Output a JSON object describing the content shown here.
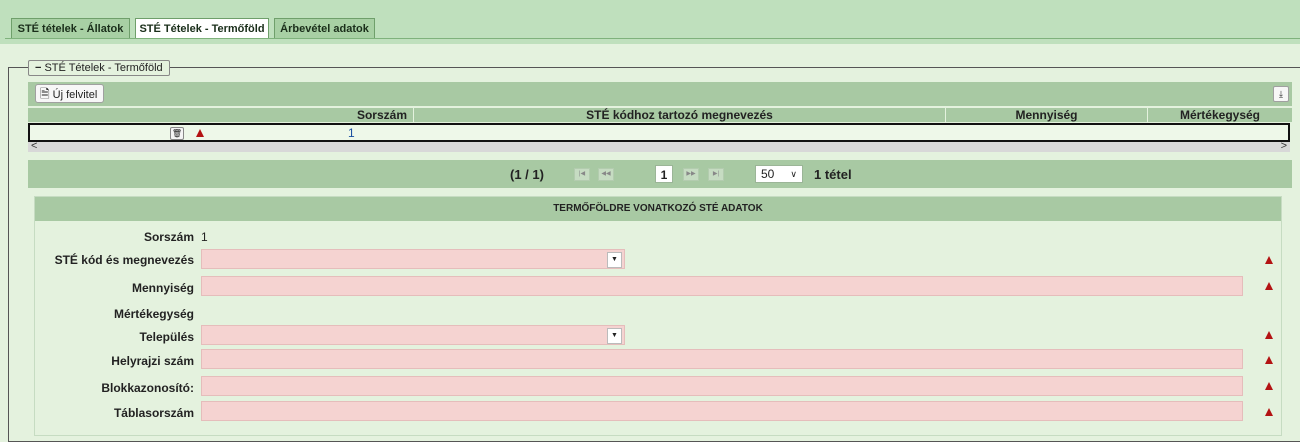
{
  "tabs": [
    {
      "label": "STÉ tételek - Állatok",
      "active": false
    },
    {
      "label": "STÉ Tételek - Termőföld",
      "active": true
    },
    {
      "label": "Árbevétel adatok",
      "active": false
    }
  ],
  "panel": {
    "legend": "STÉ Tételek - Termőföld",
    "collapse_glyph": "−",
    "new_button": "Új felvitel",
    "new_icon": "document-icon",
    "export_icon": "download-icon"
  },
  "table": {
    "columns": [
      "Sorszám",
      "STÉ kódhoz tartozó megnevezés",
      "Mennyiség",
      "Mértékegység"
    ],
    "rows": [
      {
        "sorszam": "1",
        "megnevezes": "",
        "mennyiseg": "",
        "mertekegyseg": ""
      }
    ]
  },
  "scroll": {
    "left": "<",
    "right": ">"
  },
  "pager": {
    "position": "(1 / 1)",
    "current_page": "1",
    "page_size": "50",
    "total": "1 tétel",
    "buttons": {
      "first": "|◀",
      "prev": "◀◀",
      "next": "▶▶",
      "last": "▶|"
    }
  },
  "form": {
    "title": "TERMŐFÖLDRE VONATKOZÓ STÉ ADATOK",
    "fields": {
      "sorszam": {
        "label": "Sorszám",
        "value": "1"
      },
      "ste_kod": {
        "label": "STÉ kód és megnevezés",
        "value": ""
      },
      "mennyiseg": {
        "label": "Mennyiség",
        "value": ""
      },
      "mertekegyseg": {
        "label": "Mértékegység",
        "value": ""
      },
      "telepules": {
        "label": "Település",
        "value": ""
      },
      "helyrajzi": {
        "label": "Helyrajzi szám",
        "value": ""
      },
      "blokkazonosito": {
        "label": "Blokkazonosító:",
        "value": ""
      },
      "tablasorszam": {
        "label": "Táblasorszám",
        "value": ""
      }
    }
  },
  "colors": {
    "tabbar": "#bfe0bd",
    "page": "#e4f2de",
    "header": "#a8c9a3",
    "required_input": "#f5d3d1",
    "warning": "#b31313",
    "link_blue": "#1a4fa0"
  }
}
